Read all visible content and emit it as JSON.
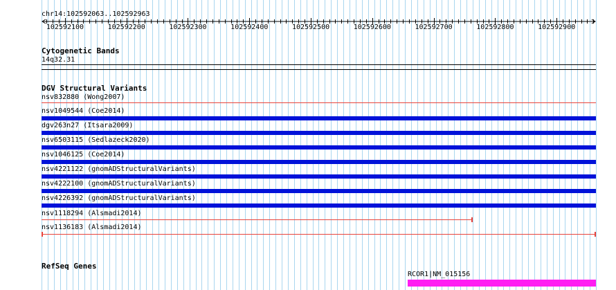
{
  "coordinate_label": "chr14:102592063..102592963",
  "ruler_ticks": [
    "102592100",
    "102592200",
    "102592300",
    "102592400",
    "102592500",
    "102592600",
    "102592700",
    "102592800",
    "102592900"
  ],
  "tracks": {
    "cytoband": {
      "title": "Cytogenetic Bands",
      "band": "14q32.31"
    },
    "dgv": {
      "title": "DGV Structural Variants",
      "items": [
        {
          "label": "nsv832880 (Wong2007)",
          "style": "thin",
          "color": "#e8433b"
        },
        {
          "label": "nsv1049544 (Coe2014)",
          "style": "thick",
          "color": "#0012d9"
        },
        {
          "label": "dgv263n27 (Itsara2009)",
          "style": "thick",
          "color": "#0012d9"
        },
        {
          "label": "nsv6503115 (Sedlazeck2020)",
          "style": "thick",
          "color": "#0012d9"
        },
        {
          "label": "nsv1046125 (Coe2014)",
          "style": "thick",
          "color": "#0012d9"
        },
        {
          "label": "nsv4221122 (gnomADStructuralVariants)",
          "style": "thick",
          "color": "#0012d9"
        },
        {
          "label": "nsv4222100 (gnomADStructuralVariants)",
          "style": "thick",
          "color": "#0012d9"
        },
        {
          "label": "nsv4226392 (gnomADStructuralVariants)",
          "style": "thick",
          "color": "#0012d9"
        },
        {
          "label": "nsv1118294 (Alsmadi2014)",
          "style": "thin-end",
          "color": "#e8433b"
        },
        {
          "label": "nsv1136183 (Alsmadi2014)",
          "style": "thin-both",
          "color": "#e8433b"
        }
      ]
    },
    "refseq": {
      "title": "RefSeq Genes",
      "gene": "RCOR1|NM_015156",
      "color": "#ff1ef2"
    }
  },
  "colors": {
    "grid": "#a9d6ef",
    "thick": "#0012d9",
    "thin": "#e8433b",
    "gene": "#ff1ef2"
  }
}
